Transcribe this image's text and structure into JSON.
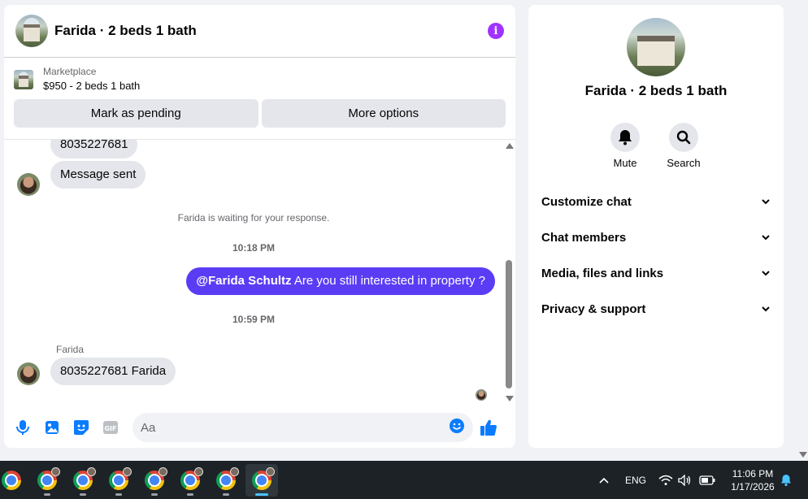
{
  "chat": {
    "title": "Farida · 2 beds 1 bath",
    "marketplace_label": "Marketplace",
    "listing": "$950 - 2 beds 1 bath",
    "mark_pending_label": "Mark as pending",
    "more_options_label": "More options",
    "messages": {
      "partial_number": "8035227681",
      "message_sent": "Message sent",
      "waiting_notice": "Farida is waiting for your response.",
      "time_1": "10:18 PM",
      "out_mention": "@Farida Schultz",
      "out_text": " Are you still interested in property ?",
      "time_2": "10:59 PM",
      "sender": "Farida",
      "last_incoming": "8035227681 Farida"
    },
    "composer_placeholder": "Aa"
  },
  "info": {
    "title": "Farida · 2 beds 1 bath",
    "mute_label": "Mute",
    "search_label": "Search",
    "rows": [
      "Customize chat",
      "Chat members",
      "Media, files and links",
      "Privacy & support"
    ]
  },
  "taskbar": {
    "lang": "ENG",
    "time": "11:06 PM",
    "date": "1/17/2026"
  },
  "colors": {
    "accent": "#a033ff",
    "outgoing_bubble": "#5b3cf5",
    "icon_blue": "#0a7cff"
  }
}
